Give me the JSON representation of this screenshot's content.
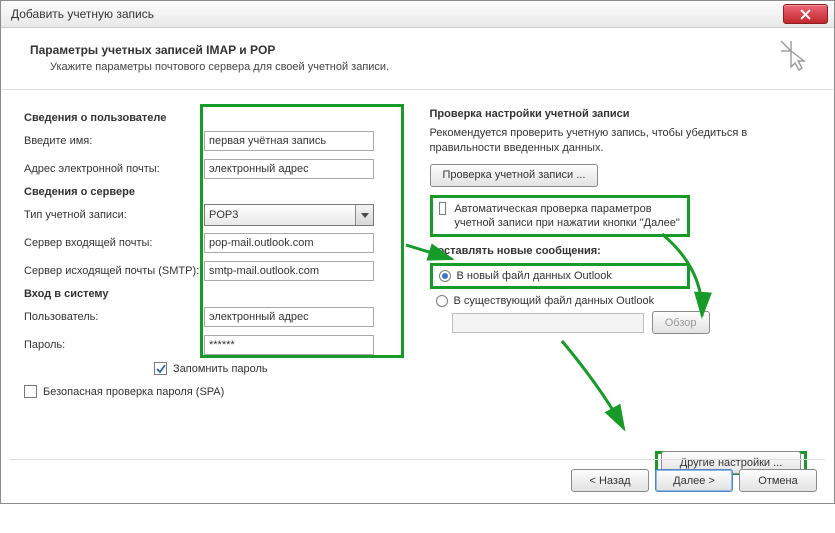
{
  "window": {
    "title": "Добавить учетную запись"
  },
  "header": {
    "title": "Параметры учетных записей IMAP и POP",
    "subtitle": "Укажите параметры почтового сервера для своей учетной записи."
  },
  "left": {
    "user_section": "Сведения о пользователе",
    "name_label": "Введите имя:",
    "name_value": "первая учётная запись",
    "email_label": "Адрес электронной почты:",
    "email_value": "электронный адрес",
    "server_section": "Сведения о сервере",
    "acct_type_label": "Тип учетной записи:",
    "acct_type_value": "POP3",
    "incoming_label": "Сервер входящей почты:",
    "incoming_value": "pop-mail.outlook.com",
    "outgoing_label": "Сервер исходящей почты (SMTP):",
    "outgoing_value": "smtp-mail.outlook.com",
    "login_section": "Вход в систему",
    "user_label": "Пользователь:",
    "user_value": "электронный адрес",
    "pass_label": "Пароль:",
    "pass_value": "******",
    "remember_label": "Запомнить пароль",
    "spa_label": "Безопасная проверка пароля (SPA)"
  },
  "right": {
    "test_section": "Проверка настройки учетной записи",
    "test_desc": "Рекомендуется проверить учетную запись, чтобы убедиться в правильности введенных данных.",
    "test_btn": "Проверка учетной записи ...",
    "auto_test_label": "Автоматическая проверка параметров учетной записи при нажатии кнопки \"Далее\"",
    "deliver_section": "Доставлять новые сообщения:",
    "deliver_new": "В новый файл данных Outlook",
    "deliver_existing": "В существующий файл данных Outlook",
    "browse_btn": "Обзор",
    "more_btn": "Другие настройки ..."
  },
  "footer": {
    "back": "< Назад",
    "next": "Далее >",
    "cancel": "Отмена"
  }
}
